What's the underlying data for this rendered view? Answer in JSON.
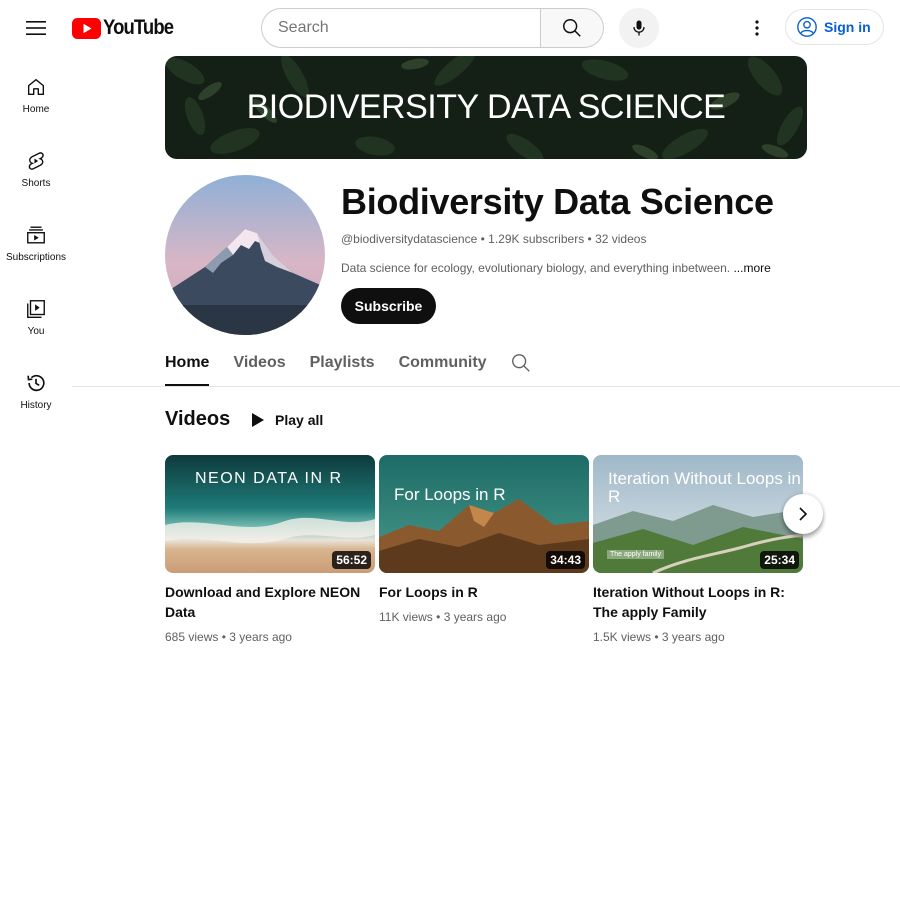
{
  "header": {
    "logo_text": "YouTube",
    "search_placeholder": "Search",
    "signin_label": "Sign in",
    "colors": {
      "logo_red": "#ff0000",
      "link_blue": "#065fd4"
    }
  },
  "guide": {
    "items": [
      {
        "label": "Home",
        "icon": "home-icon"
      },
      {
        "label": "Shorts",
        "icon": "shorts-icon"
      },
      {
        "label": "Subscriptions",
        "icon": "subscriptions-icon"
      },
      {
        "label": "You",
        "icon": "you-icon"
      },
      {
        "label": "History",
        "icon": "history-icon"
      }
    ]
  },
  "channel": {
    "banner_text": "BIODIVERSITY DATA SCIENCE",
    "name": "Biodiversity Data Science",
    "handle": "@biodiversitydatascience",
    "subscribers": "1.29K subscribers",
    "video_count": "32 videos",
    "description": "Data science for ecology, evolutionary biology, and everything inbetween.",
    "more_label": "...more",
    "subscribe_label": "Subscribe"
  },
  "tabs": [
    {
      "label": "Home",
      "active": true
    },
    {
      "label": "Videos",
      "active": false
    },
    {
      "label": "Playlists",
      "active": false
    },
    {
      "label": "Community",
      "active": false
    }
  ],
  "section": {
    "title": "Videos",
    "play_all_label": "Play all"
  },
  "videos": [
    {
      "thumb_text": "NEON DATA IN R",
      "duration": "56:52",
      "title": "Download and Explore NEON Data",
      "views": "685 views",
      "age": "3 years ago"
    },
    {
      "thumb_text": "For Loops in R",
      "duration": "34:43",
      "title": "For Loops in R",
      "views": "11K views",
      "age": "3 years ago"
    },
    {
      "thumb_text": "Iteration Without Loops in R",
      "thumb_caption": "The apply family",
      "duration": "25:34",
      "title": "Iteration Without Loops in R: The apply Family",
      "views": "1.5K views",
      "age": "3 years ago"
    }
  ],
  "separator": "•"
}
